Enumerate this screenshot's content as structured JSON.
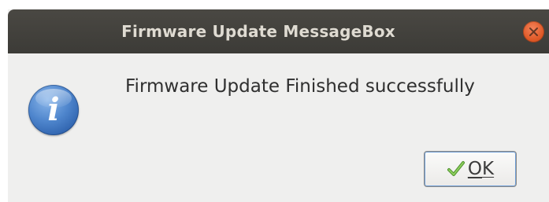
{
  "window": {
    "title": "Firmware Update MessageBox"
  },
  "icons": {
    "close": "close-icon",
    "info": "info-icon",
    "check": "check-icon"
  },
  "info_glyph": "i",
  "message": "Firmware Update Finished successfully",
  "buttons": {
    "ok_label": "OK"
  },
  "colors": {
    "titlebar": "#3c3b37",
    "close_button": "#e05a28",
    "dialog_background": "#efefee",
    "info_icon": "#4f86cd",
    "check_mark": "#6ab04c"
  }
}
